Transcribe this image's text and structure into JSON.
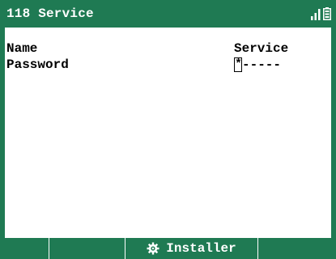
{
  "header": {
    "title": "118 Service",
    "signal_icon": "signal-bars-icon",
    "battery_icon": "battery-icon"
  },
  "fields": {
    "name": {
      "label": "Name",
      "value": "Service"
    },
    "password": {
      "label": "Password",
      "cursor_char": "*",
      "value": "-----"
    }
  },
  "softkeys": {
    "key1": "",
    "key2": "",
    "key3": {
      "icon": "gear-icon",
      "label": "Installer"
    },
    "key4": ""
  },
  "colors": {
    "accent": "#1f7a53",
    "background": "#ffffff",
    "text": "#000000"
  }
}
